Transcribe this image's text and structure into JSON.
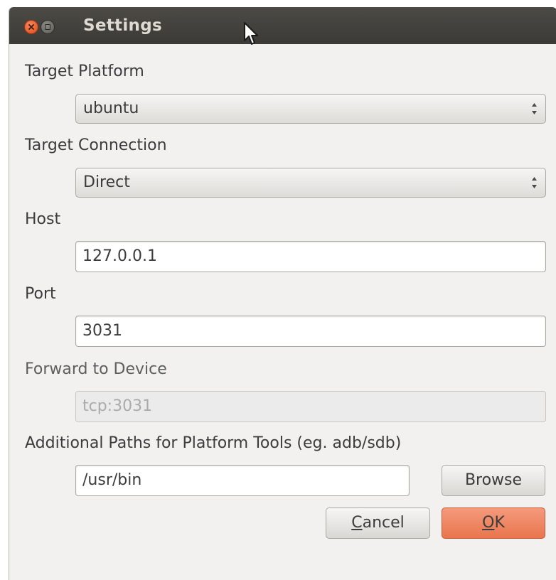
{
  "window": {
    "title": "Settings"
  },
  "form": {
    "target_platform_label": "Target Platform",
    "target_platform_value": "ubuntu",
    "target_connection_label": "Target Connection",
    "target_connection_value": "Direct",
    "host_label": "Host",
    "host_value": "127.0.0.1",
    "port_label": "Port",
    "port_value": "3031",
    "forward_label": "Forward to Device",
    "forward_value": "tcp:3031",
    "paths_label": "Additional Paths for Platform Tools (eg. adb/sdb)",
    "paths_value": "/usr/bin"
  },
  "buttons": {
    "browse": "Browse",
    "cancel_mnemonic": "C",
    "cancel_rest": "ancel",
    "ok_mnemonic": "O",
    "ok_rest": "K"
  },
  "colors": {
    "titlebar": "#3c3b37",
    "accent_ok": "#ec7d55",
    "close_button": "#e4561f"
  },
  "icons": {
    "close": "close-icon",
    "minimize": "minimize-icon",
    "combo_arrows": "updown-arrows-icon",
    "cursor": "mouse-pointer-icon"
  }
}
